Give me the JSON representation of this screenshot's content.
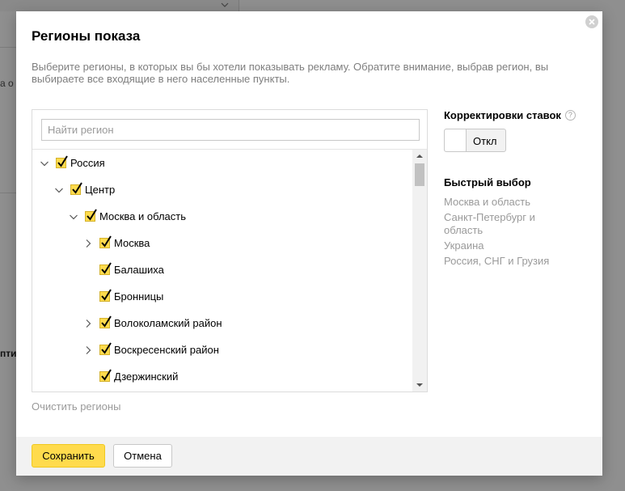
{
  "background": {
    "left_texts": [
      "а о",
      "пти"
    ]
  },
  "modal": {
    "title": "Регионы показа",
    "description": "Выберите регионы, в которых вы бы хотели показывать рекламу. Обратите внимание, выбрав регион, вы выбираете все входящие в него населенные пункты.",
    "close_icon": "close-icon"
  },
  "search": {
    "placeholder": "Найти регион",
    "value": ""
  },
  "tree": [
    {
      "label": "Россия",
      "checked": true,
      "expander": "expanded"
    },
    {
      "label": "Центр",
      "checked": true,
      "expander": "expanded"
    },
    {
      "label": "Москва и область",
      "checked": true,
      "expander": "expanded"
    },
    {
      "label": "Москва",
      "checked": true,
      "expander": "collapsed"
    },
    {
      "label": "Балашиха",
      "checked": true,
      "expander": "none"
    },
    {
      "label": "Бронницы",
      "checked": true,
      "expander": "none"
    },
    {
      "label": "Волоколамский район",
      "checked": true,
      "expander": "collapsed"
    },
    {
      "label": "Воскресенский район",
      "checked": true,
      "expander": "collapsed"
    },
    {
      "label": "Дзержинский",
      "checked": true,
      "expander": "none"
    }
  ],
  "clear_regions": "Очистить регионы",
  "bid_adjustments": {
    "heading": "Корректировки ставок",
    "help_icon": "?",
    "toggle_label": "Откл",
    "toggle_on": false
  },
  "quick_select": {
    "heading": "Быстрый выбор",
    "items": [
      "Москва и область",
      "Санкт-Петербург и область",
      "Украина",
      "Россия, СНГ и Грузия"
    ]
  },
  "footer": {
    "save_label": "Сохранить",
    "cancel_label": "Отмена"
  },
  "colors": {
    "accent": "#ffdb4d",
    "muted_text": "#9a9a9a",
    "footer_bg": "#f2f2f2"
  }
}
